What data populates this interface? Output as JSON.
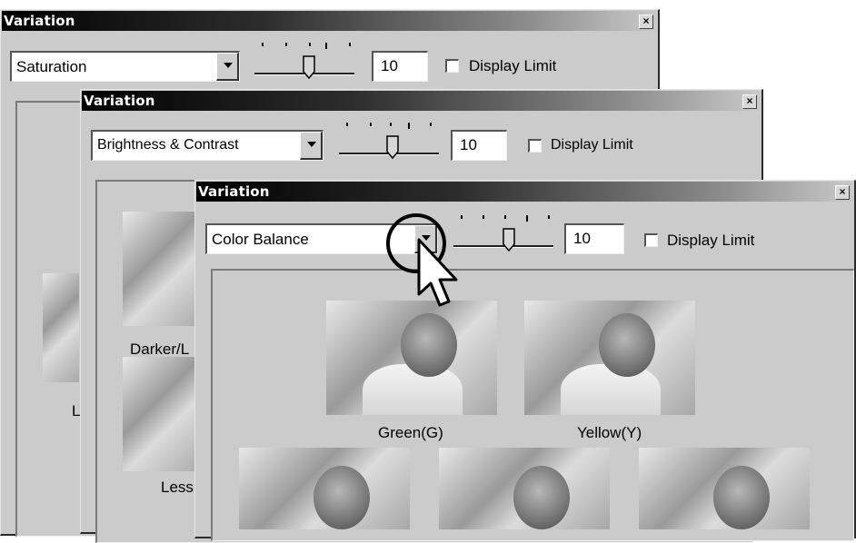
{
  "windows": [
    {
      "title": "Variation",
      "close_glyph": "×",
      "dropdown_value": "Saturation",
      "level_value": "10",
      "display_limit_label": "Display Limit",
      "display_limit_checked": false,
      "slider_level": 0.55,
      "thumbnail_labels": [
        "L"
      ]
    },
    {
      "title": "Variation",
      "close_glyph": "×",
      "dropdown_value": "Brightness & Contrast",
      "level_value": "10",
      "display_limit_label": "Display Limit",
      "display_limit_checked": false,
      "slider_level": 0.55,
      "thumbnail_labels": [
        "Darker/L",
        "Less"
      ]
    },
    {
      "title": "Variation",
      "close_glyph": "×",
      "dropdown_value": "Color Balance",
      "level_value": "10",
      "display_limit_label": "Display Limit",
      "display_limit_checked": false,
      "slider_level": 0.55,
      "thumbnail_labels": [
        "Green(G)",
        "Yellow(Y)"
      ]
    }
  ],
  "icons": {
    "dropdown_arrow": "triangle-down",
    "cursor": "arrow-pointer-icon"
  }
}
